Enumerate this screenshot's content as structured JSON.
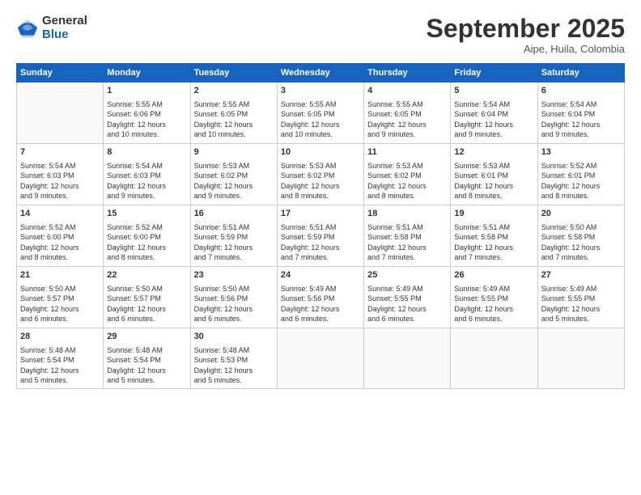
{
  "logo": {
    "general": "General",
    "blue": "Blue"
  },
  "header": {
    "month_title": "September 2025",
    "subtitle": "Aipe, Huila, Colombia"
  },
  "days_of_week": [
    "Sunday",
    "Monday",
    "Tuesday",
    "Wednesday",
    "Thursday",
    "Friday",
    "Saturday"
  ],
  "weeks": [
    [
      {
        "num": "",
        "content": ""
      },
      {
        "num": "1",
        "content": "Sunrise: 5:55 AM\nSunset: 6:06 PM\nDaylight: 12 hours\nand 10 minutes."
      },
      {
        "num": "2",
        "content": "Sunrise: 5:55 AM\nSunset: 6:05 PM\nDaylight: 12 hours\nand 10 minutes."
      },
      {
        "num": "3",
        "content": "Sunrise: 5:55 AM\nSunset: 6:05 PM\nDaylight: 12 hours\nand 10 minutes."
      },
      {
        "num": "4",
        "content": "Sunrise: 5:55 AM\nSunset: 6:05 PM\nDaylight: 12 hours\nand 9 minutes."
      },
      {
        "num": "5",
        "content": "Sunrise: 5:54 AM\nSunset: 6:04 PM\nDaylight: 12 hours\nand 9 minutes."
      },
      {
        "num": "6",
        "content": "Sunrise: 5:54 AM\nSunset: 6:04 PM\nDaylight: 12 hours\nand 9 minutes."
      }
    ],
    [
      {
        "num": "7",
        "content": "Sunrise: 5:54 AM\nSunset: 6:03 PM\nDaylight: 12 hours\nand 9 minutes."
      },
      {
        "num": "8",
        "content": "Sunrise: 5:54 AM\nSunset: 6:03 PM\nDaylight: 12 hours\nand 9 minutes."
      },
      {
        "num": "9",
        "content": "Sunrise: 5:53 AM\nSunset: 6:02 PM\nDaylight: 12 hours\nand 9 minutes."
      },
      {
        "num": "10",
        "content": "Sunrise: 5:53 AM\nSunset: 6:02 PM\nDaylight: 12 hours\nand 8 minutes."
      },
      {
        "num": "11",
        "content": "Sunrise: 5:53 AM\nSunset: 6:02 PM\nDaylight: 12 hours\nand 8 minutes."
      },
      {
        "num": "12",
        "content": "Sunrise: 5:53 AM\nSunset: 6:01 PM\nDaylight: 12 hours\nand 8 minutes."
      },
      {
        "num": "13",
        "content": "Sunrise: 5:52 AM\nSunset: 6:01 PM\nDaylight: 12 hours\nand 8 minutes."
      }
    ],
    [
      {
        "num": "14",
        "content": "Sunrise: 5:52 AM\nSunset: 6:00 PM\nDaylight: 12 hours\nand 8 minutes."
      },
      {
        "num": "15",
        "content": "Sunrise: 5:52 AM\nSunset: 6:00 PM\nDaylight: 12 hours\nand 8 minutes."
      },
      {
        "num": "16",
        "content": "Sunrise: 5:51 AM\nSunset: 5:59 PM\nDaylight: 12 hours\nand 7 minutes."
      },
      {
        "num": "17",
        "content": "Sunrise: 5:51 AM\nSunset: 5:59 PM\nDaylight: 12 hours\nand 7 minutes."
      },
      {
        "num": "18",
        "content": "Sunrise: 5:51 AM\nSunset: 5:58 PM\nDaylight: 12 hours\nand 7 minutes."
      },
      {
        "num": "19",
        "content": "Sunrise: 5:51 AM\nSunset: 5:58 PM\nDaylight: 12 hours\nand 7 minutes."
      },
      {
        "num": "20",
        "content": "Sunrise: 5:50 AM\nSunset: 5:58 PM\nDaylight: 12 hours\nand 7 minutes."
      }
    ],
    [
      {
        "num": "21",
        "content": "Sunrise: 5:50 AM\nSunset: 5:57 PM\nDaylight: 12 hours\nand 6 minutes."
      },
      {
        "num": "22",
        "content": "Sunrise: 5:50 AM\nSunset: 5:57 PM\nDaylight: 12 hours\nand 6 minutes."
      },
      {
        "num": "23",
        "content": "Sunrise: 5:50 AM\nSunset: 5:56 PM\nDaylight: 12 hours\nand 6 minutes."
      },
      {
        "num": "24",
        "content": "Sunrise: 5:49 AM\nSunset: 5:56 PM\nDaylight: 12 hours\nand 6 minutes."
      },
      {
        "num": "25",
        "content": "Sunrise: 5:49 AM\nSunset: 5:55 PM\nDaylight: 12 hours\nand 6 minutes."
      },
      {
        "num": "26",
        "content": "Sunrise: 5:49 AM\nSunset: 5:55 PM\nDaylight: 12 hours\nand 6 minutes."
      },
      {
        "num": "27",
        "content": "Sunrise: 5:49 AM\nSunset: 5:55 PM\nDaylight: 12 hours\nand 5 minutes."
      }
    ],
    [
      {
        "num": "28",
        "content": "Sunrise: 5:48 AM\nSunset: 5:54 PM\nDaylight: 12 hours\nand 5 minutes."
      },
      {
        "num": "29",
        "content": "Sunrise: 5:48 AM\nSunset: 5:54 PM\nDaylight: 12 hours\nand 5 minutes."
      },
      {
        "num": "30",
        "content": "Sunrise: 5:48 AM\nSunset: 5:53 PM\nDaylight: 12 hours\nand 5 minutes."
      },
      {
        "num": "",
        "content": ""
      },
      {
        "num": "",
        "content": ""
      },
      {
        "num": "",
        "content": ""
      },
      {
        "num": "",
        "content": ""
      }
    ]
  ]
}
